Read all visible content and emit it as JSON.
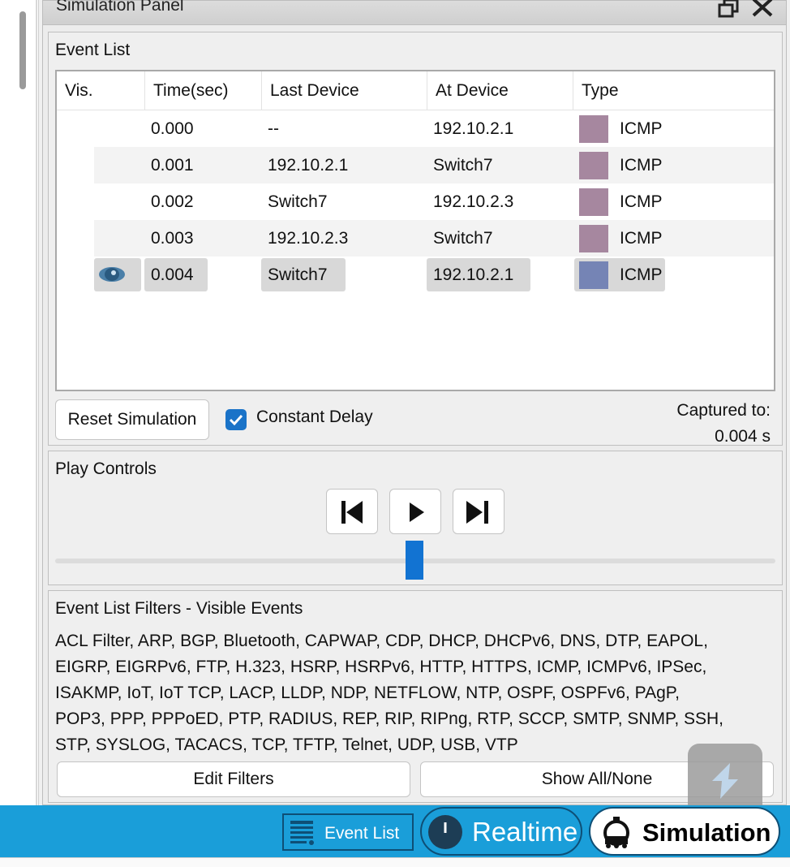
{
  "panel": {
    "title": "Simulation Panel"
  },
  "event_list": {
    "section_title": "Event List",
    "columns": [
      "Vis.",
      "Time(sec)",
      "Last Device",
      "At Device",
      "Type"
    ],
    "rows": [
      {
        "vis": "",
        "time": "0.000",
        "last_device": "--",
        "at_device": "192.10.2.1",
        "type": "ICMP",
        "color": "#a6879f"
      },
      {
        "vis": "",
        "time": "0.001",
        "last_device": "192.10.2.1",
        "at_device": "Switch7",
        "type": "ICMP",
        "color": "#a6879f"
      },
      {
        "vis": "",
        "time": "0.002",
        "last_device": "Switch7",
        "at_device": "192.10.2.3",
        "type": "ICMP",
        "color": "#a6879f"
      },
      {
        "vis": "",
        "time": "0.003",
        "last_device": "192.10.2.3",
        "at_device": "Switch7",
        "type": "ICMP",
        "color": "#a6879f"
      },
      {
        "vis": "eye-icon",
        "time": "0.004",
        "last_device": "Switch7",
        "at_device": "192.10.2.1",
        "type": "ICMP",
        "color": "#7584b5",
        "selected": true
      }
    ],
    "reset_label": "Reset Simulation",
    "constant_delay_label": "Constant Delay",
    "constant_delay_checked": true,
    "captured_label": "Captured to:",
    "captured_value": "0.004 s"
  },
  "play_controls": {
    "section_title": "Play Controls",
    "buttons": [
      "back-icon",
      "play-icon",
      "forward-icon"
    ],
    "slider_level": 0.5
  },
  "filters": {
    "section_title": "Event List Filters - Visible Events",
    "lines": [
      "ACL Filter, ARP, BGP, Bluetooth, CAPWAP, CDP, DHCP, DHCPv6, DNS, DTP, EAPOL,",
      "EIGRP, EIGRPv6, FTP, H.323, HSRP, HSRPv6, HTTP, HTTPS, ICMP, ICMPv6, IPSec,",
      "ISAKMP, IoT, IoT TCP, LACP, LLDP, NDP, NETFLOW, NTP, OSPF, OSPFv6, PAgP,",
      "POP3, PPP, PPPoED, PTP, RADIUS, REP, RIP, RIPng, RTP, SCCP, SMTP, SNMP, SSH,",
      "STP, SYSLOG, TACACS, TCP, TFTP, Telnet, UDP, USB, VTP"
    ],
    "edit_label": "Edit Filters",
    "show_label": "Show All/None"
  },
  "bottom_bar": {
    "event_list_label": "Event List",
    "realtime_label": "Realtime",
    "simulation_label": "Simulation"
  },
  "colors": {
    "accent": "#1a9ed9",
    "checkbox": "#1a73c8",
    "slider": "#1273d2"
  }
}
